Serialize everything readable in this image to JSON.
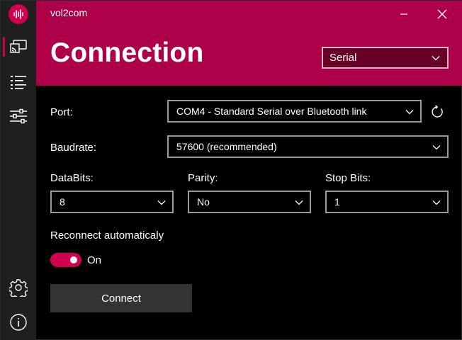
{
  "app": {
    "title": "vol2com"
  },
  "header": {
    "page_title": "Connection",
    "mode_select": {
      "value": "Serial"
    }
  },
  "form": {
    "port": {
      "label": "Port:",
      "value": "COM4 - Standard Serial over Bluetooth link"
    },
    "baudrate": {
      "label": "Baudrate:",
      "value": "57600 (recommended)"
    },
    "databits": {
      "label": "DataBits:",
      "value": "8"
    },
    "parity": {
      "label": "Parity:",
      "value": "No"
    },
    "stopbits": {
      "label": "Stop Bits:",
      "value": "1"
    },
    "reconnect": {
      "label": "Reconnect automaticaly",
      "state_label": "On",
      "enabled": true
    }
  },
  "actions": {
    "connect_label": "Connect"
  },
  "nav": {
    "items": [
      {
        "icon": "cast-icon",
        "active": true
      },
      {
        "icon": "list-icon",
        "active": false
      },
      {
        "icon": "sliders-icon",
        "active": false
      }
    ],
    "bottom": [
      {
        "icon": "gear-icon"
      },
      {
        "icon": "info-icon"
      }
    ]
  },
  "colors": {
    "accent": "#d1004f",
    "header_bg": "#ad0048",
    "select_bg": "#690027",
    "rail_bg": "#1f1f1f",
    "button_bg": "#333333"
  }
}
